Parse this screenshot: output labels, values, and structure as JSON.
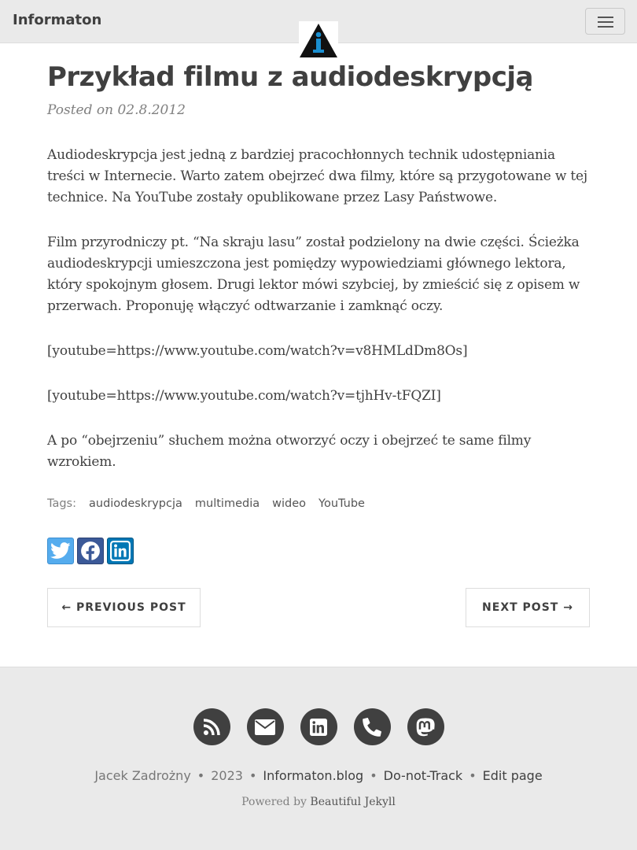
{
  "navbar": {
    "brand": "Informaton",
    "menu_icon": "hamburger-icon",
    "logo_icon": "info-triangle-icon"
  },
  "post": {
    "title": "Przykład filmu z audiodeskrypcją",
    "meta": "Posted on 02.8.2012",
    "paragraphs": [
      "Audiodeskrypcja jest jedną z bardziej pracochłonnych technik udostępniania treści w Internecie. Warto zatem obejrzeć dwa filmy, które są przygotowane w tej technice. Na YouTube zostały opublikowane przez Lasy Państwowe.",
      "Film przyrodniczy pt. “Na skraju lasu” został podzielony na dwie części. Ścieżka audiodeskrypcji umieszczona jest pomiędzy wypowiedziami głównego lektora, który spokojnym głosem. Drugi lektor mówi szybciej, by zmieścić się z opisem w przerwach. Proponuję włączyć odtwarzanie i zamknąć oczy.",
      "[youtube=https://www.youtube.com/watch?v=v8HMLdDm8Os]",
      "[youtube=https://www.youtube.com/watch?v=tjhHv-tFQZI]",
      "A po “obejrzeniu” słuchem można otworzyć oczy i obejrzeć te same filmy wzrokiem."
    ],
    "tags_label": "Tags:",
    "tags": [
      "audiodeskrypcja",
      "multimedia",
      "wideo",
      "YouTube"
    ],
    "share": [
      {
        "icon": "twitter-icon",
        "color": "#55acee"
      },
      {
        "icon": "facebook-icon",
        "color": "#3b5998"
      },
      {
        "icon": "linkedin-icon",
        "color": "#0077b5"
      }
    ]
  },
  "pager": {
    "previous": "← PREVIOUS POST",
    "next": "NEXT POST →"
  },
  "footer": {
    "icons": [
      "rss-icon",
      "envelope-icon",
      "linkedin-icon",
      "phone-icon",
      "mastodon-icon"
    ],
    "author": "Jacek Zadrożny",
    "year": "2023",
    "site": "Informaton.blog",
    "dnt": "Do-not-Track",
    "edit": "Edit page",
    "powered_prefix": "Powered by",
    "powered_link": "Beautiful Jekyll"
  }
}
